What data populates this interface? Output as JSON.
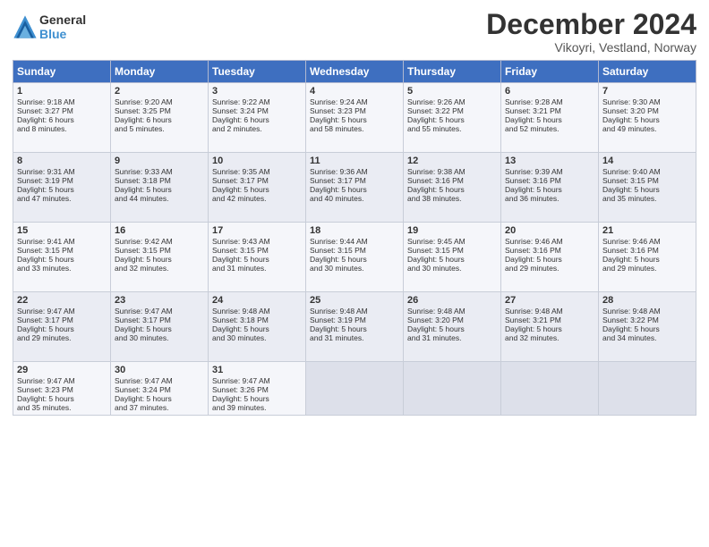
{
  "header": {
    "logo_line1": "General",
    "logo_line2": "Blue",
    "month_title": "December 2024",
    "location": "Vikoyri, Vestland, Norway"
  },
  "days_of_week": [
    "Sunday",
    "Monday",
    "Tuesday",
    "Wednesday",
    "Thursday",
    "Friday",
    "Saturday"
  ],
  "weeks": [
    [
      {
        "day": "1",
        "lines": [
          "Sunrise: 9:18 AM",
          "Sunset: 3:27 PM",
          "Daylight: 6 hours",
          "and 8 minutes."
        ]
      },
      {
        "day": "2",
        "lines": [
          "Sunrise: 9:20 AM",
          "Sunset: 3:25 PM",
          "Daylight: 6 hours",
          "and 5 minutes."
        ]
      },
      {
        "day": "3",
        "lines": [
          "Sunrise: 9:22 AM",
          "Sunset: 3:24 PM",
          "Daylight: 6 hours",
          "and 2 minutes."
        ]
      },
      {
        "day": "4",
        "lines": [
          "Sunrise: 9:24 AM",
          "Sunset: 3:23 PM",
          "Daylight: 5 hours",
          "and 58 minutes."
        ]
      },
      {
        "day": "5",
        "lines": [
          "Sunrise: 9:26 AM",
          "Sunset: 3:22 PM",
          "Daylight: 5 hours",
          "and 55 minutes."
        ]
      },
      {
        "day": "6",
        "lines": [
          "Sunrise: 9:28 AM",
          "Sunset: 3:21 PM",
          "Daylight: 5 hours",
          "and 52 minutes."
        ]
      },
      {
        "day": "7",
        "lines": [
          "Sunrise: 9:30 AM",
          "Sunset: 3:20 PM",
          "Daylight: 5 hours",
          "and 49 minutes."
        ]
      }
    ],
    [
      {
        "day": "8",
        "lines": [
          "Sunrise: 9:31 AM",
          "Sunset: 3:19 PM",
          "Daylight: 5 hours",
          "and 47 minutes."
        ]
      },
      {
        "day": "9",
        "lines": [
          "Sunrise: 9:33 AM",
          "Sunset: 3:18 PM",
          "Daylight: 5 hours",
          "and 44 minutes."
        ]
      },
      {
        "day": "10",
        "lines": [
          "Sunrise: 9:35 AM",
          "Sunset: 3:17 PM",
          "Daylight: 5 hours",
          "and 42 minutes."
        ]
      },
      {
        "day": "11",
        "lines": [
          "Sunrise: 9:36 AM",
          "Sunset: 3:17 PM",
          "Daylight: 5 hours",
          "and 40 minutes."
        ]
      },
      {
        "day": "12",
        "lines": [
          "Sunrise: 9:38 AM",
          "Sunset: 3:16 PM",
          "Daylight: 5 hours",
          "and 38 minutes."
        ]
      },
      {
        "day": "13",
        "lines": [
          "Sunrise: 9:39 AM",
          "Sunset: 3:16 PM",
          "Daylight: 5 hours",
          "and 36 minutes."
        ]
      },
      {
        "day": "14",
        "lines": [
          "Sunrise: 9:40 AM",
          "Sunset: 3:15 PM",
          "Daylight: 5 hours",
          "and 35 minutes."
        ]
      }
    ],
    [
      {
        "day": "15",
        "lines": [
          "Sunrise: 9:41 AM",
          "Sunset: 3:15 PM",
          "Daylight: 5 hours",
          "and 33 minutes."
        ]
      },
      {
        "day": "16",
        "lines": [
          "Sunrise: 9:42 AM",
          "Sunset: 3:15 PM",
          "Daylight: 5 hours",
          "and 32 minutes."
        ]
      },
      {
        "day": "17",
        "lines": [
          "Sunrise: 9:43 AM",
          "Sunset: 3:15 PM",
          "Daylight: 5 hours",
          "and 31 minutes."
        ]
      },
      {
        "day": "18",
        "lines": [
          "Sunrise: 9:44 AM",
          "Sunset: 3:15 PM",
          "Daylight: 5 hours",
          "and 30 minutes."
        ]
      },
      {
        "day": "19",
        "lines": [
          "Sunrise: 9:45 AM",
          "Sunset: 3:15 PM",
          "Daylight: 5 hours",
          "and 30 minutes."
        ]
      },
      {
        "day": "20",
        "lines": [
          "Sunrise: 9:46 AM",
          "Sunset: 3:16 PM",
          "Daylight: 5 hours",
          "and 29 minutes."
        ]
      },
      {
        "day": "21",
        "lines": [
          "Sunrise: 9:46 AM",
          "Sunset: 3:16 PM",
          "Daylight: 5 hours",
          "and 29 minutes."
        ]
      }
    ],
    [
      {
        "day": "22",
        "lines": [
          "Sunrise: 9:47 AM",
          "Sunset: 3:17 PM",
          "Daylight: 5 hours",
          "and 29 minutes."
        ]
      },
      {
        "day": "23",
        "lines": [
          "Sunrise: 9:47 AM",
          "Sunset: 3:17 PM",
          "Daylight: 5 hours",
          "and 30 minutes."
        ]
      },
      {
        "day": "24",
        "lines": [
          "Sunrise: 9:48 AM",
          "Sunset: 3:18 PM",
          "Daylight: 5 hours",
          "and 30 minutes."
        ]
      },
      {
        "day": "25",
        "lines": [
          "Sunrise: 9:48 AM",
          "Sunset: 3:19 PM",
          "Daylight: 5 hours",
          "and 31 minutes."
        ]
      },
      {
        "day": "26",
        "lines": [
          "Sunrise: 9:48 AM",
          "Sunset: 3:20 PM",
          "Daylight: 5 hours",
          "and 31 minutes."
        ]
      },
      {
        "day": "27",
        "lines": [
          "Sunrise: 9:48 AM",
          "Sunset: 3:21 PM",
          "Daylight: 5 hours",
          "and 32 minutes."
        ]
      },
      {
        "day": "28",
        "lines": [
          "Sunrise: 9:48 AM",
          "Sunset: 3:22 PM",
          "Daylight: 5 hours",
          "and 34 minutes."
        ]
      }
    ],
    [
      {
        "day": "29",
        "lines": [
          "Sunrise: 9:47 AM",
          "Sunset: 3:23 PM",
          "Daylight: 5 hours",
          "and 35 minutes."
        ]
      },
      {
        "day": "30",
        "lines": [
          "Sunrise: 9:47 AM",
          "Sunset: 3:24 PM",
          "Daylight: 5 hours",
          "and 37 minutes."
        ]
      },
      {
        "day": "31",
        "lines": [
          "Sunrise: 9:47 AM",
          "Sunset: 3:26 PM",
          "Daylight: 5 hours",
          "and 39 minutes."
        ]
      },
      {
        "day": "",
        "lines": []
      },
      {
        "day": "",
        "lines": []
      },
      {
        "day": "",
        "lines": []
      },
      {
        "day": "",
        "lines": []
      }
    ]
  ]
}
